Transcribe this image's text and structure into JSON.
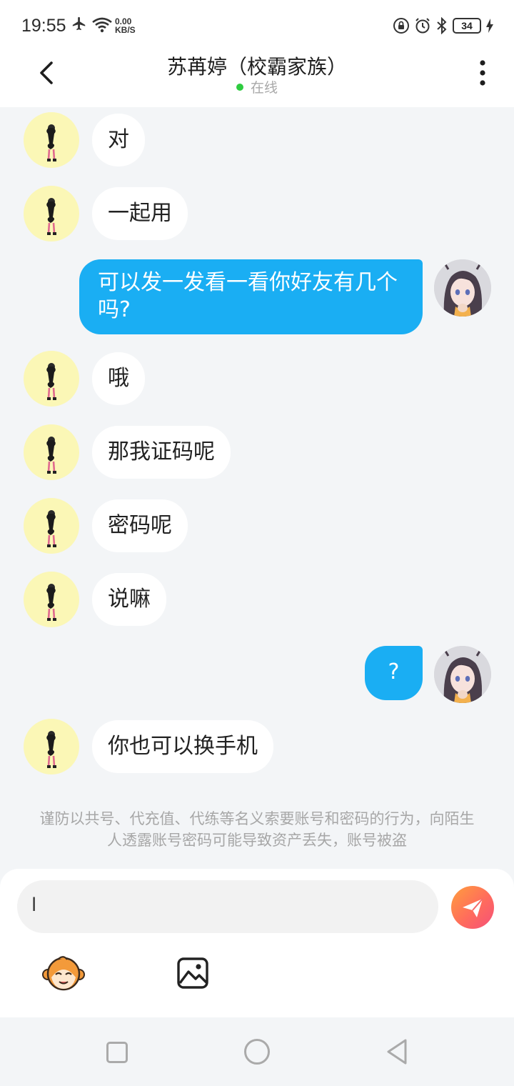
{
  "status_bar": {
    "time": "19:55",
    "net_speed_value": "0.00",
    "net_speed_unit": "KB/S",
    "battery": "34"
  },
  "header": {
    "title": "苏苒婷（校霸家族）",
    "status": "在线"
  },
  "messages": [
    {
      "side": "left",
      "text": "对"
    },
    {
      "side": "left",
      "text": "一起用"
    },
    {
      "side": "right",
      "text": "可以发一发看一看你好友有几个吗?"
    },
    {
      "side": "left",
      "text": "哦"
    },
    {
      "side": "left",
      "text": "那我证码呢"
    },
    {
      "side": "left",
      "text": "密码呢"
    },
    {
      "side": "left",
      "text": "说嘛"
    },
    {
      "side": "right",
      "text": "?"
    },
    {
      "side": "left",
      "text": "你也可以换手机"
    }
  ],
  "warning": "谨防以共号、代充值、代练等名义索要账号和密码的行为，向陌生人透露账号密码可能导致资产丢失，账号被盗",
  "input": {
    "value": "l"
  },
  "colors": {
    "bubble_right": "#1aaef3",
    "bubble_left": "#ffffff",
    "avatar_left_bg": "#fbf7b6",
    "online_dot": "#2ecc40",
    "send_gradient_start": "#ff9f3d",
    "send_gradient_end": "#f5507a"
  },
  "icons": {
    "back": "chevron-left-icon",
    "more": "more-vertical-icon",
    "send": "paper-plane-icon",
    "emoji": "monkey-emoji-icon",
    "image": "image-icon"
  }
}
